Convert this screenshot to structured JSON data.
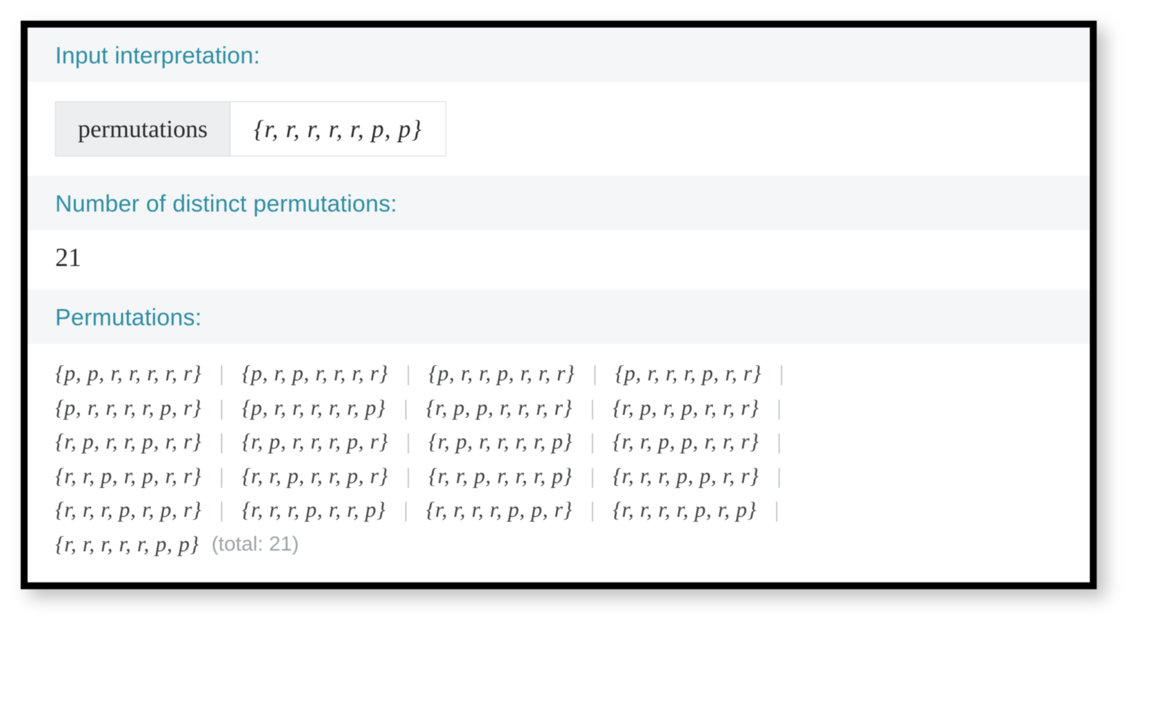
{
  "sections": {
    "input_header": "Input interpretation:",
    "count_header": "Number of distinct permutations:",
    "perm_header": "Permutations:"
  },
  "input": {
    "operation_label": "permutations",
    "multiset": "{r, r, r, r, r, p, p}"
  },
  "count": "21",
  "permutations": [
    "{p, p, r, r, r, r, r}",
    "{p, r, p, r, r, r, r}",
    "{p, r, r, p, r, r, r}",
    "{p, r, r, r, p, r, r}",
    "{p, r, r, r, r, p, r}",
    "{p, r, r, r, r, r, p}",
    "{r, p, p, r, r, r, r}",
    "{r, p, r, p, r, r, r}",
    "{r, p, r, r, p, r, r}",
    "{r, p, r, r, r, p, r}",
    "{r, p, r, r, r, r, p}",
    "{r, r, p, p, r, r, r}",
    "{r, r, p, r, p, r, r}",
    "{r, r, p, r, r, p, r}",
    "{r, r, p, r, r, r, p}",
    "{r, r, r, p, p, r, r}",
    "{r, r, r, p, r, p, r}",
    "{r, r, r, p, r, r, p}",
    "{r, r, r, r, p, p, r}",
    "{r, r, r, r, p, r, p}",
    "{r, r, r, r, r, p, p}"
  ],
  "perm_columns": 4,
  "total_note": "(total: 21)"
}
